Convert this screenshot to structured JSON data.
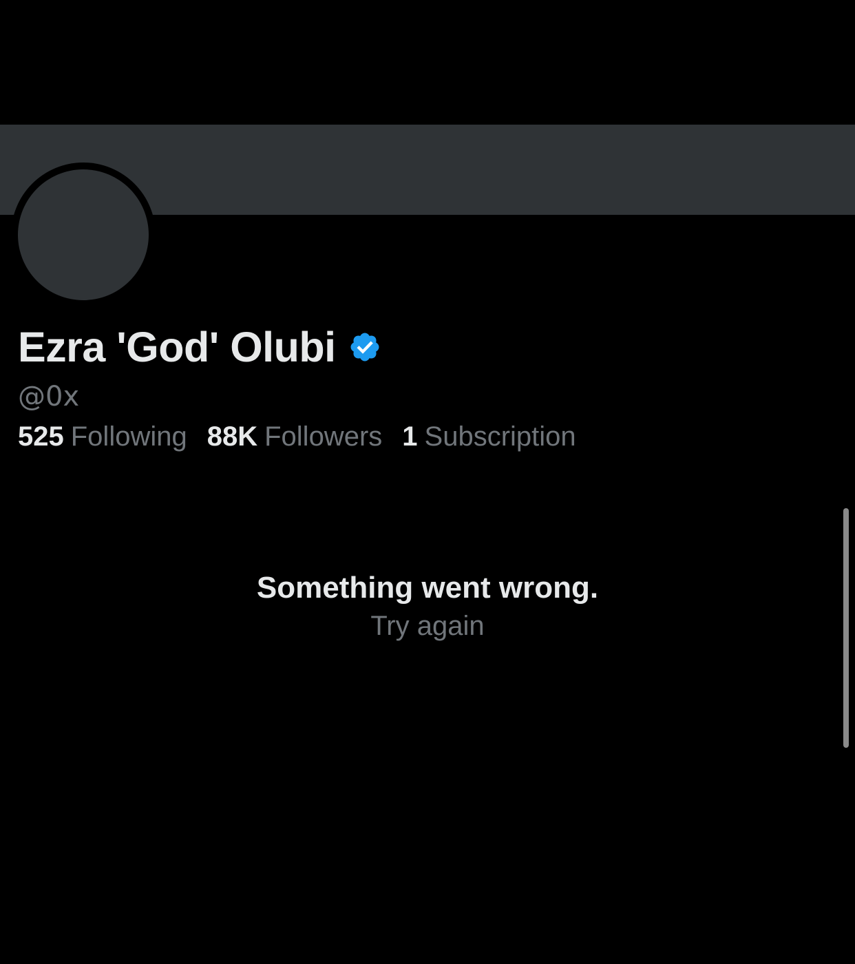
{
  "profile": {
    "display_name": "Ezra 'God' Olubi",
    "handle": "@0x",
    "verified": true,
    "verified_badge_icon": "verified-badge-icon",
    "avatar_icon": "avatar-placeholder"
  },
  "stats": {
    "following_count": "525",
    "following_label": "Following",
    "followers_count": "88K",
    "followers_label": "Followers",
    "subscriptions_count": "1",
    "subscriptions_label": "Subscription"
  },
  "error": {
    "message": "Something went wrong.",
    "retry_label": "Try again"
  },
  "colors": {
    "background": "#000000",
    "banner": "#2f3336",
    "primary_text": "#e7e9ea",
    "secondary_text": "#71767b",
    "verified_blue": "#1d9bf0"
  }
}
